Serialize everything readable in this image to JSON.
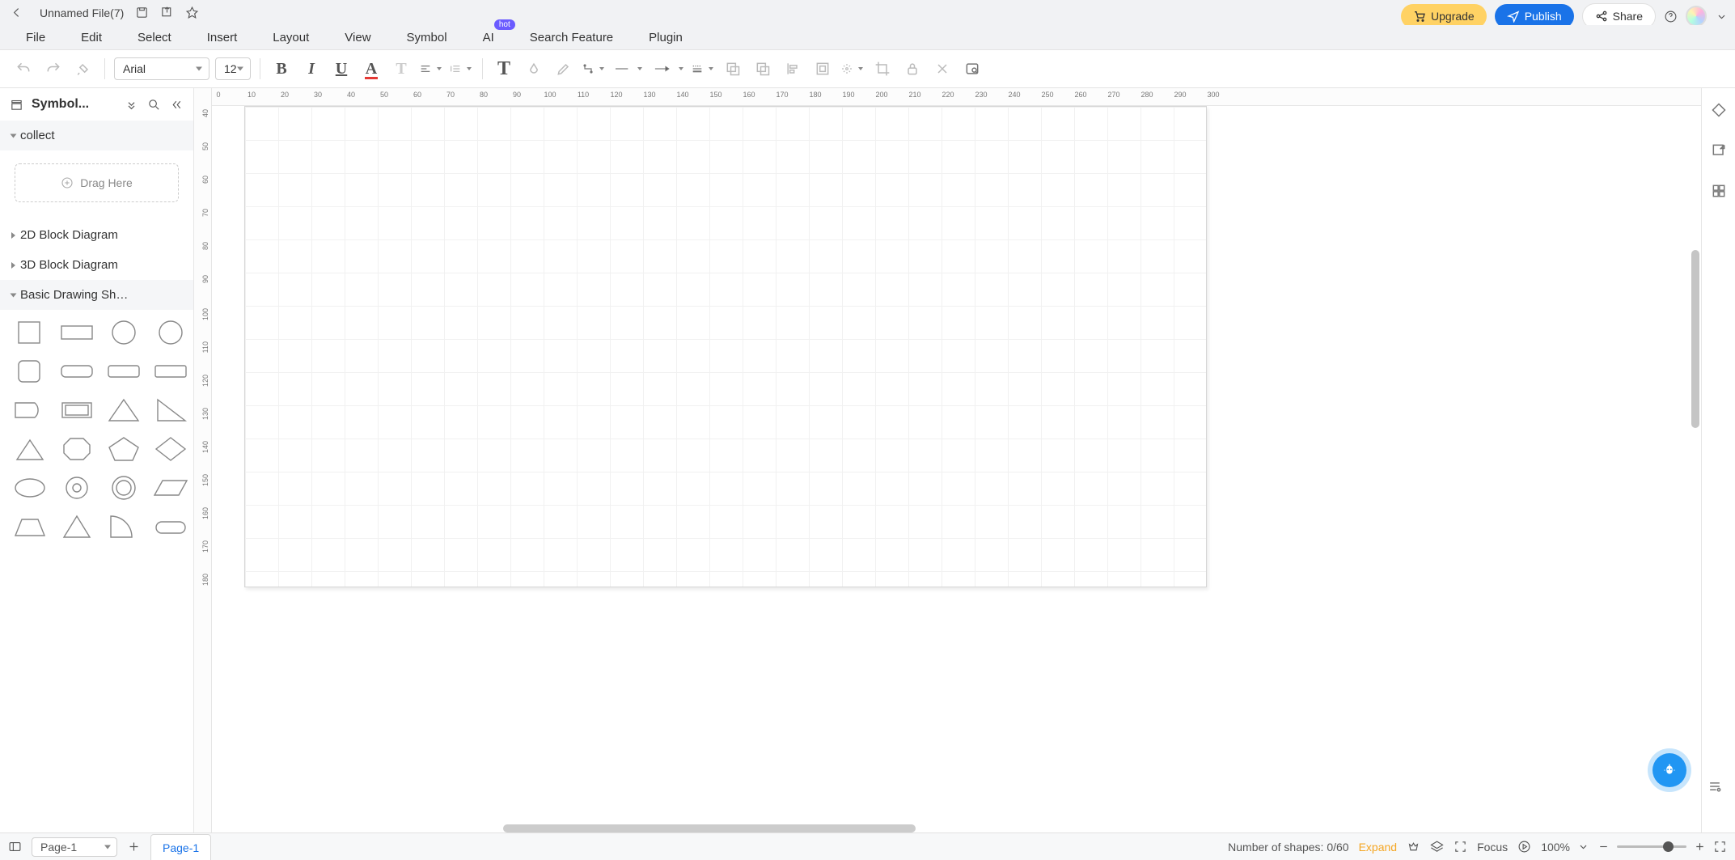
{
  "header": {
    "filename": "Unnamed File(7)",
    "upgrade_label": "Upgrade",
    "publish_label": "Publish",
    "share_label": "Share"
  },
  "menubar": {
    "file": "File",
    "edit": "Edit",
    "select": "Select",
    "insert": "Insert",
    "layout": "Layout",
    "view": "View",
    "symbol": "Symbol",
    "ai": "AI",
    "ai_badge": "hot",
    "search_feature": "Search Feature",
    "plugin": "Plugin"
  },
  "toolbar": {
    "font_family": "Arial",
    "font_size": "12"
  },
  "sidebar": {
    "title": "Symbol...",
    "drag_here": "Drag Here",
    "categories": {
      "collect": "collect",
      "block2d": "2D Block Diagram",
      "block3d": "3D Block Diagram",
      "basic_shapes": "Basic Drawing Sh…"
    }
  },
  "ruler_h": [
    "0",
    "10",
    "20",
    "30",
    "40",
    "50",
    "60",
    "70",
    "80",
    "90",
    "100",
    "110",
    "120",
    "130",
    "140",
    "150",
    "160",
    "170",
    "180",
    "190",
    "200",
    "210",
    "220",
    "230",
    "240",
    "250",
    "260",
    "270",
    "280",
    "290",
    "300"
  ],
  "ruler_v": [
    "40",
    "50",
    "60",
    "70",
    "80",
    "90",
    "100",
    "110",
    "120",
    "130",
    "140",
    "150",
    "160",
    "170",
    "180"
  ],
  "status": {
    "page_select": "Page-1",
    "page_tab": "Page-1",
    "shapes_count": "Number of shapes: 0/60",
    "expand": "Expand",
    "focus": "Focus",
    "zoom": "100%"
  }
}
